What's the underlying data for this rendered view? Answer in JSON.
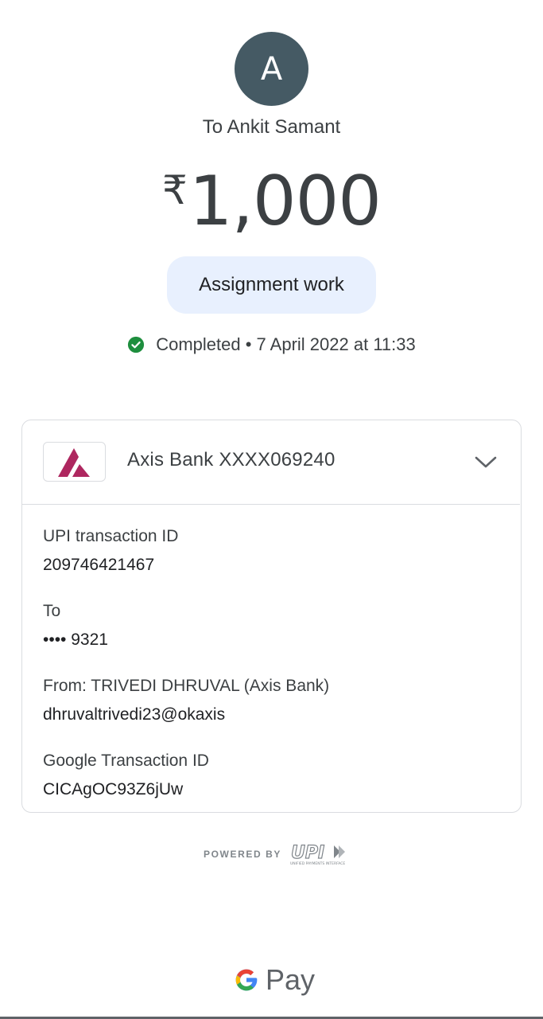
{
  "header": {
    "avatar_initial": "A",
    "recipient": "To Ankit Samant",
    "currency_symbol": "₹",
    "amount": "1,000",
    "note": "Assignment work",
    "status": "Completed • 7 April 2022 at 11:33",
    "status_color": "#1e8e3e"
  },
  "account": {
    "bank_name": "Axis Bank XXXX069240",
    "logo_color": "#ae275f"
  },
  "details": [
    {
      "label": "UPI transaction ID",
      "value": "209746421467"
    },
    {
      "label": "To",
      "value": "•••• 9321"
    },
    {
      "label": "From: TRIVEDI DHRUVAL (Axis Bank)",
      "value": "dhruvaltrivedi23@okaxis"
    },
    {
      "label": "Google Transaction ID",
      "value": "CICAgOC93Z6jUw"
    }
  ],
  "footer": {
    "powered_by": "POWERED BY",
    "upi_logo_text": "UPI",
    "upi_tagline": "UNIFIED PAYMENTS INTERFACE",
    "brand_pay": "Pay"
  }
}
